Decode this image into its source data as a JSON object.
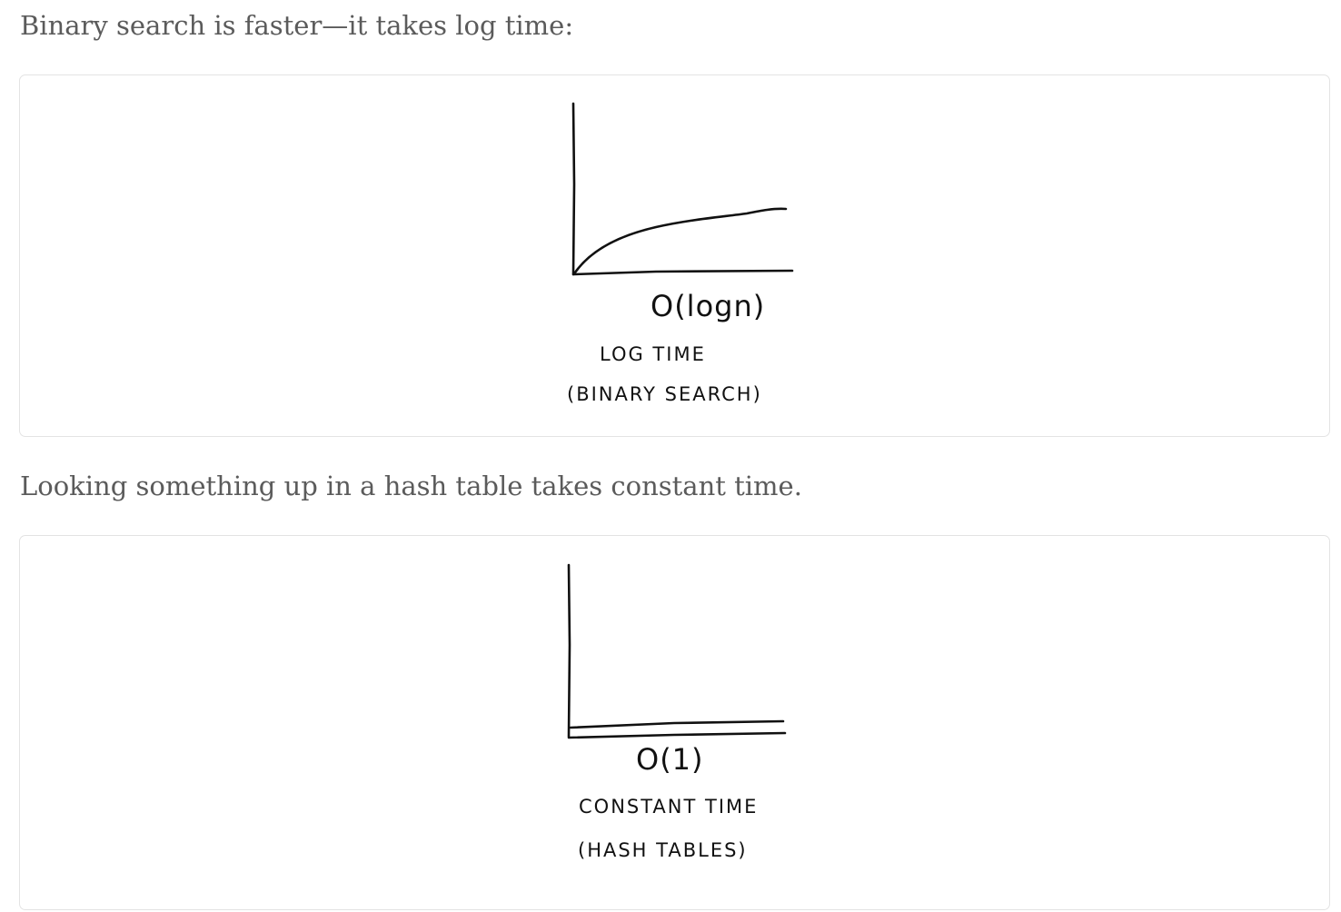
{
  "paragraphs": {
    "binary_search": "Binary search is faster—it takes log time:",
    "hash_table": "Looking something up in a hash table takes constant time."
  },
  "figures": {
    "log_time": {
      "notation": "O(logn)",
      "label": "LOG TIME",
      "sublabel": "(BINARY SEARCH)"
    },
    "constant_time": {
      "notation": "O(1)",
      "label": "CONSTANT TIME",
      "sublabel": "(HASH TABLES)"
    }
  },
  "colors": {
    "text": "#5b5b5b",
    "ink": "#111111",
    "card_border": "#e3e3e3"
  }
}
